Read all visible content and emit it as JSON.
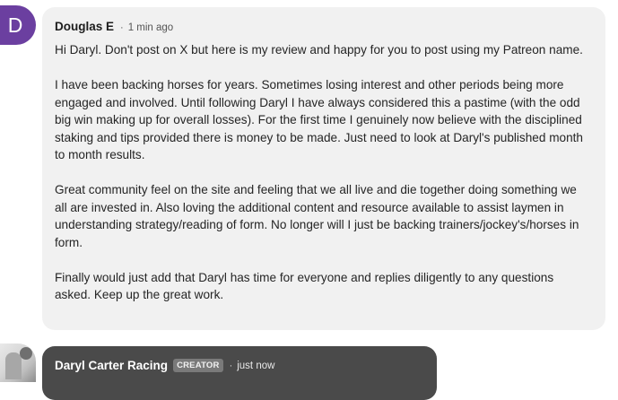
{
  "comment": {
    "avatar_letter": "D",
    "author": "Douglas E",
    "separator": "·",
    "time": "1 min ago",
    "paragraphs": [
      "Hi Daryl. Don't post on X but here is my review and happy for you to post using my Patreon name.",
      "I have been backing horses for years. Sometimes losing interest and other periods being more engaged and involved. Until following Daryl I have always considered this a pastime (with the odd big win making up for overall losses). For the first time I genuinely now believe with the disciplined staking and tips provided there is money to be made. Just need to look at Daryl's published month to month results.",
      "Great community feel on the site and feeling that we all live and die together doing something we all are invested in. Also loving the additional content and resource available to assist laymen in understanding strategy/reading of form. No longer will I just be backing trainers/jockey's/horses in form.",
      "Finally would just add that Daryl has time for everyone and replies diligently to any questions asked. Keep up the great work."
    ]
  },
  "reply": {
    "author": "Daryl Carter Racing",
    "badge": "CREATOR",
    "separator": "·",
    "time": "just now"
  },
  "colors": {
    "avatar_bg": "#6b3fa0",
    "comment_bg": "#f1f1f1",
    "reply_bg": "#4a4a4a",
    "badge_bg": "#7a7a7a"
  }
}
